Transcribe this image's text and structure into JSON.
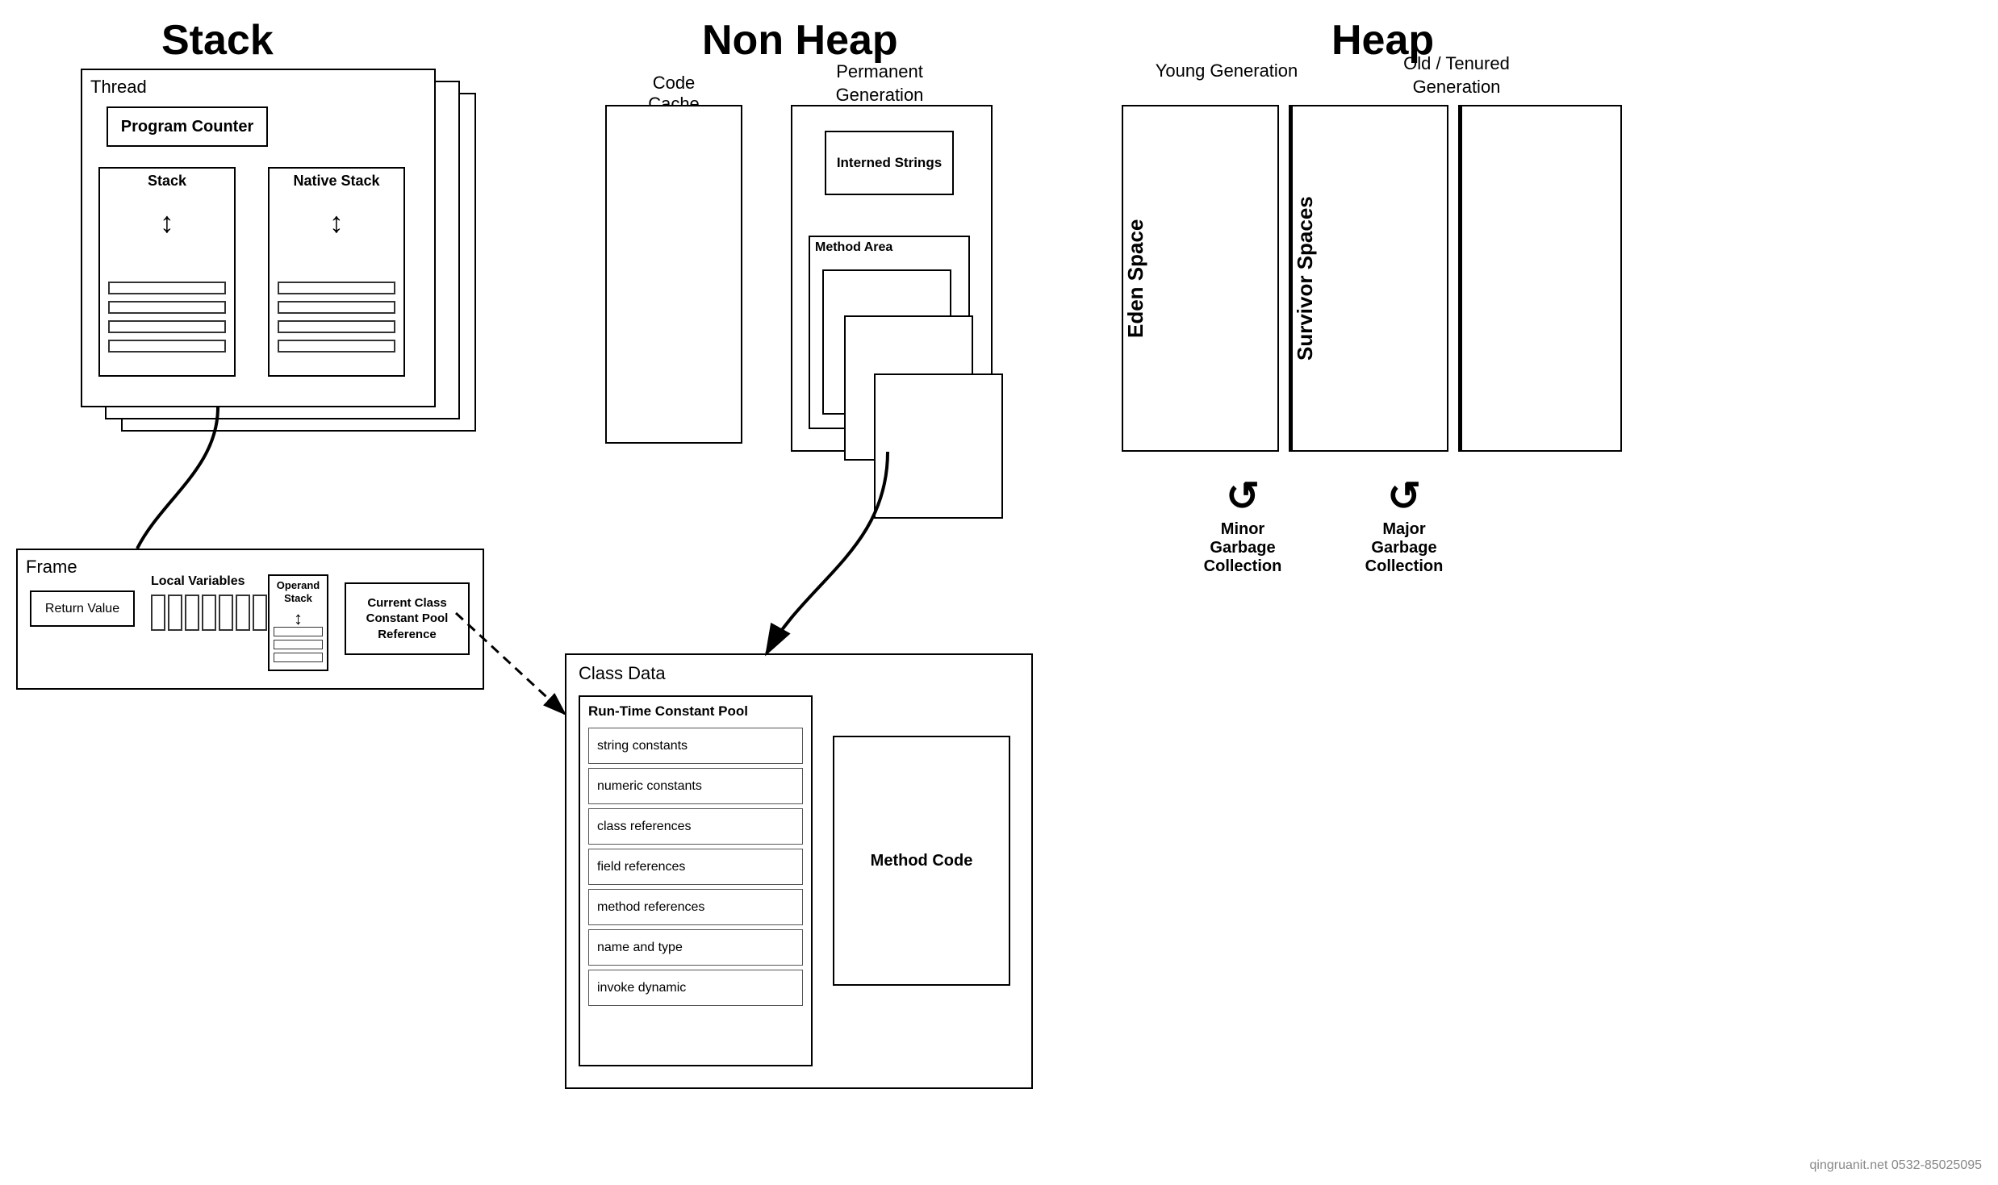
{
  "titles": {
    "stack": "Stack",
    "non_heap": "Non Heap",
    "heap": "Heap"
  },
  "stack": {
    "thread_label": "Thread",
    "program_counter": "Program Counter",
    "stack_label": "Stack",
    "native_stack_label": "Native Stack",
    "frame_label": "Frame",
    "return_value": "Return Value",
    "local_variables": "Local Variables",
    "operand_stack": "Operand Stack",
    "ccpr": "Current Class Constant Pool Reference"
  },
  "non_heap": {
    "code_cache_title": "Code Cache",
    "perm_gen_title": "Permanent Generation",
    "interned_strings": "Interned Strings",
    "method_area": "Method Area"
  },
  "heap": {
    "young_gen_title": "Young Generation",
    "old_gen_title": "Old / Tenured Generation",
    "eden_label": "Eden Space",
    "survivor_label": "Survivor Spaces",
    "minor_gc": "Minor Garbage Collection",
    "major_gc": "Major Garbage Collection"
  },
  "class_data": {
    "label": "Class Data",
    "rcp_label": "Run-Time Constant Pool",
    "rcp_items": [
      "string constants",
      "numeric constants",
      "class references",
      "field references",
      "method references",
      "name and type",
      "invoke dynamic"
    ],
    "method_code": "Method Code"
  },
  "watermark": "qingruanit.net 0532-85025095"
}
